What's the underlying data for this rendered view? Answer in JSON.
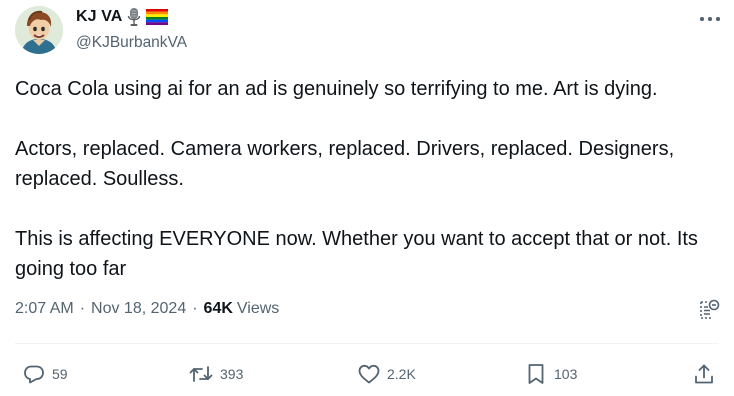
{
  "author": {
    "display_name": "KJ VA",
    "handle": "@KJBurbankVA",
    "badges": [
      "microphone-emoji",
      "rainbow-flag-emoji"
    ]
  },
  "tweet": {
    "paragraphs": [
      "Coca Cola using ai for an ad is genuinely so terrifying to me. Art is dying.",
      "Actors, replaced. Camera workers, replaced. Drivers, replaced. Designers, replaced. Soulless.",
      "This is affecting EVERYONE now. Whether you want to accept that or not. Its going too far"
    ]
  },
  "meta": {
    "time": "2:07 AM",
    "separator": "·",
    "date": "Nov 18, 2024",
    "views_count": "64K",
    "views_label": "Views"
  },
  "actions": {
    "replies": "59",
    "reposts": "393",
    "likes": "2.2K",
    "bookmarks": "103"
  },
  "colors": {
    "text": "#0f1419",
    "secondary": "#536471",
    "divider": "#eff3f4"
  }
}
